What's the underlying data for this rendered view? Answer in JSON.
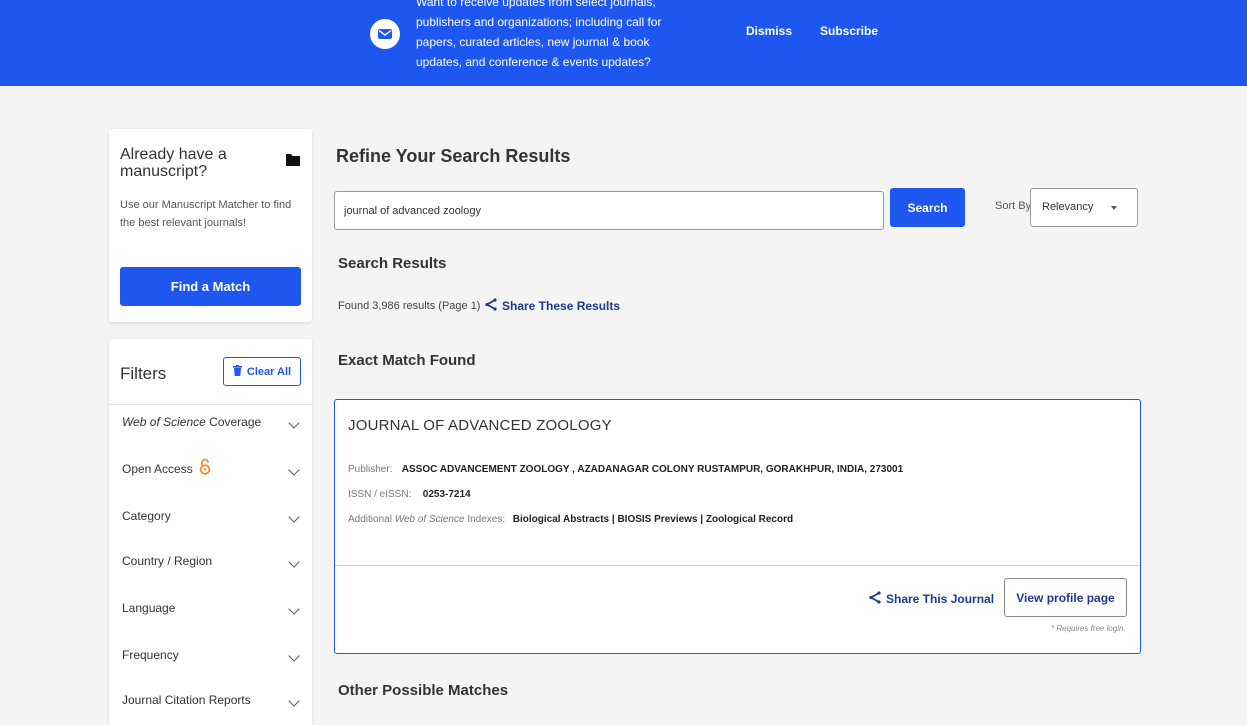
{
  "banner": {
    "text_lines": [
      "Want to receive updates from select journals,",
      "publishers and organizations; including call for",
      "papers, curated articles, new journal & book",
      "updates, and conference & events updates?"
    ],
    "dismiss_label": "Dismiss",
    "subscribe_label": "Subscribe",
    "icon": "mail-icon"
  },
  "manuscript": {
    "title": "Already have a manuscript?",
    "description": "Use our Manuscript Matcher to find the best relevant journals!",
    "button_label": "Find a Match",
    "icon": "folder-icon"
  },
  "filters": {
    "title": "Filters",
    "clear_label": "Clear All",
    "items": [
      {
        "label_em": "Web of Science",
        "label_rest": " Coverage"
      },
      {
        "label": "Open Access",
        "icon": "open-access-icon"
      },
      {
        "label": "Category"
      },
      {
        "label": "Country / Region"
      },
      {
        "label": "Language"
      },
      {
        "label": "Frequency"
      },
      {
        "label": "Journal Citation Reports"
      }
    ]
  },
  "search": {
    "page_title": "Refine Your Search Results",
    "query": "journal of advanced zoology",
    "button_label": "Search",
    "sort_label": "Sort By:",
    "sort_value": "Relevancy"
  },
  "results": {
    "title": "Search Results",
    "found_text": "Found 3,986 results (Page 1)",
    "share_label": "Share These Results",
    "exact_title": "Exact Match Found",
    "other_title": "Other Possible Matches"
  },
  "journal": {
    "name": "JOURNAL OF ADVANCED ZOOLOGY",
    "publisher_label": "Publisher:",
    "publisher": "ASSOC ADVANCEMENT ZOOLOGY , AZADANAGAR COLONY RUSTAMPUR, GORAKHPUR, INDIA, 273001",
    "issn_label": "ISSN / eISSN:",
    "issn": "0253-7214",
    "indexes_label_pre": "Additional ",
    "indexes_label_em": "Web of Science",
    "indexes_label_post": " Indexes:",
    "indexes": "Biological Abstracts | BIOSIS Previews | Zoological Record",
    "share_label": "Share This Journal",
    "profile_label": "View profile page",
    "login_note": "* Requires free login."
  },
  "colors": {
    "brand_blue": "#1e56f0",
    "link_navy": "#1e3a8a",
    "open_access_orange": "#f28c28"
  }
}
